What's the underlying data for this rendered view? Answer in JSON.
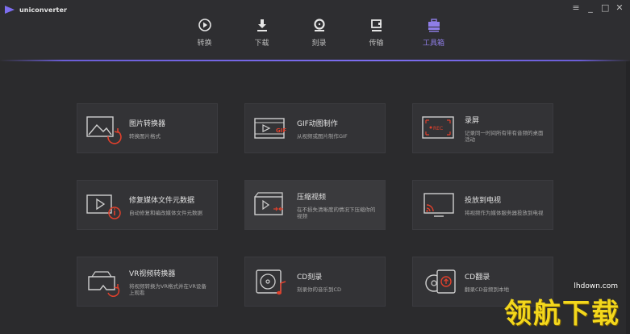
{
  "app": {
    "name": "uniconverter"
  },
  "window_controls": {
    "menu": "≡",
    "minimize": "_",
    "maximize": "□",
    "close": "✕"
  },
  "nav": {
    "tabs": [
      {
        "label": "转换",
        "icon": "convert-icon",
        "active": false
      },
      {
        "label": "下载",
        "icon": "download-icon",
        "active": false
      },
      {
        "label": "刻录",
        "icon": "burn-icon",
        "active": false
      },
      {
        "label": "传输",
        "icon": "transfer-icon",
        "active": false
      },
      {
        "label": "工具箱",
        "icon": "toolbox-icon",
        "active": true
      }
    ]
  },
  "tools": [
    {
      "title": "图片转换器",
      "desc": "转换图片格式",
      "icon": "image-convert-icon"
    },
    {
      "title": "GIF动图制作",
      "desc": "从视频或图片制作GIF",
      "icon": "gif-maker-icon"
    },
    {
      "title": "录屏",
      "desc": "记录同一时间所有带有音频的桌面活动",
      "icon": "screen-record-icon"
    },
    {
      "title": "修复媒体文件元数据",
      "desc": "自动修复和编改媒体文件元数据",
      "icon": "metadata-fix-icon"
    },
    {
      "title": "压缩视频",
      "desc": "在不损失清晰度的情况下压缩你的视频",
      "icon": "compress-video-icon"
    },
    {
      "title": "投放到电视",
      "desc": "将视频作为媒体服务器投放到电视",
      "icon": "cast-tv-icon"
    },
    {
      "title": "VR视频转换器",
      "desc": "将视频转换为VR格式并在VR设备上观看",
      "icon": "vr-convert-icon"
    },
    {
      "title": "CD刻录",
      "desc": "刻录你的音乐到CD",
      "icon": "cd-burn-icon"
    },
    {
      "title": "CD翻录",
      "desc": "翻录CD音频到本地",
      "icon": "cd-rip-icon"
    }
  ],
  "watermark": {
    "url": "lhdown.com",
    "text": "领航下载"
  },
  "colors": {
    "accent": "#7d6ef0",
    "alert": "#e0402c",
    "background": "#2b2b2d",
    "card": "#333336"
  }
}
